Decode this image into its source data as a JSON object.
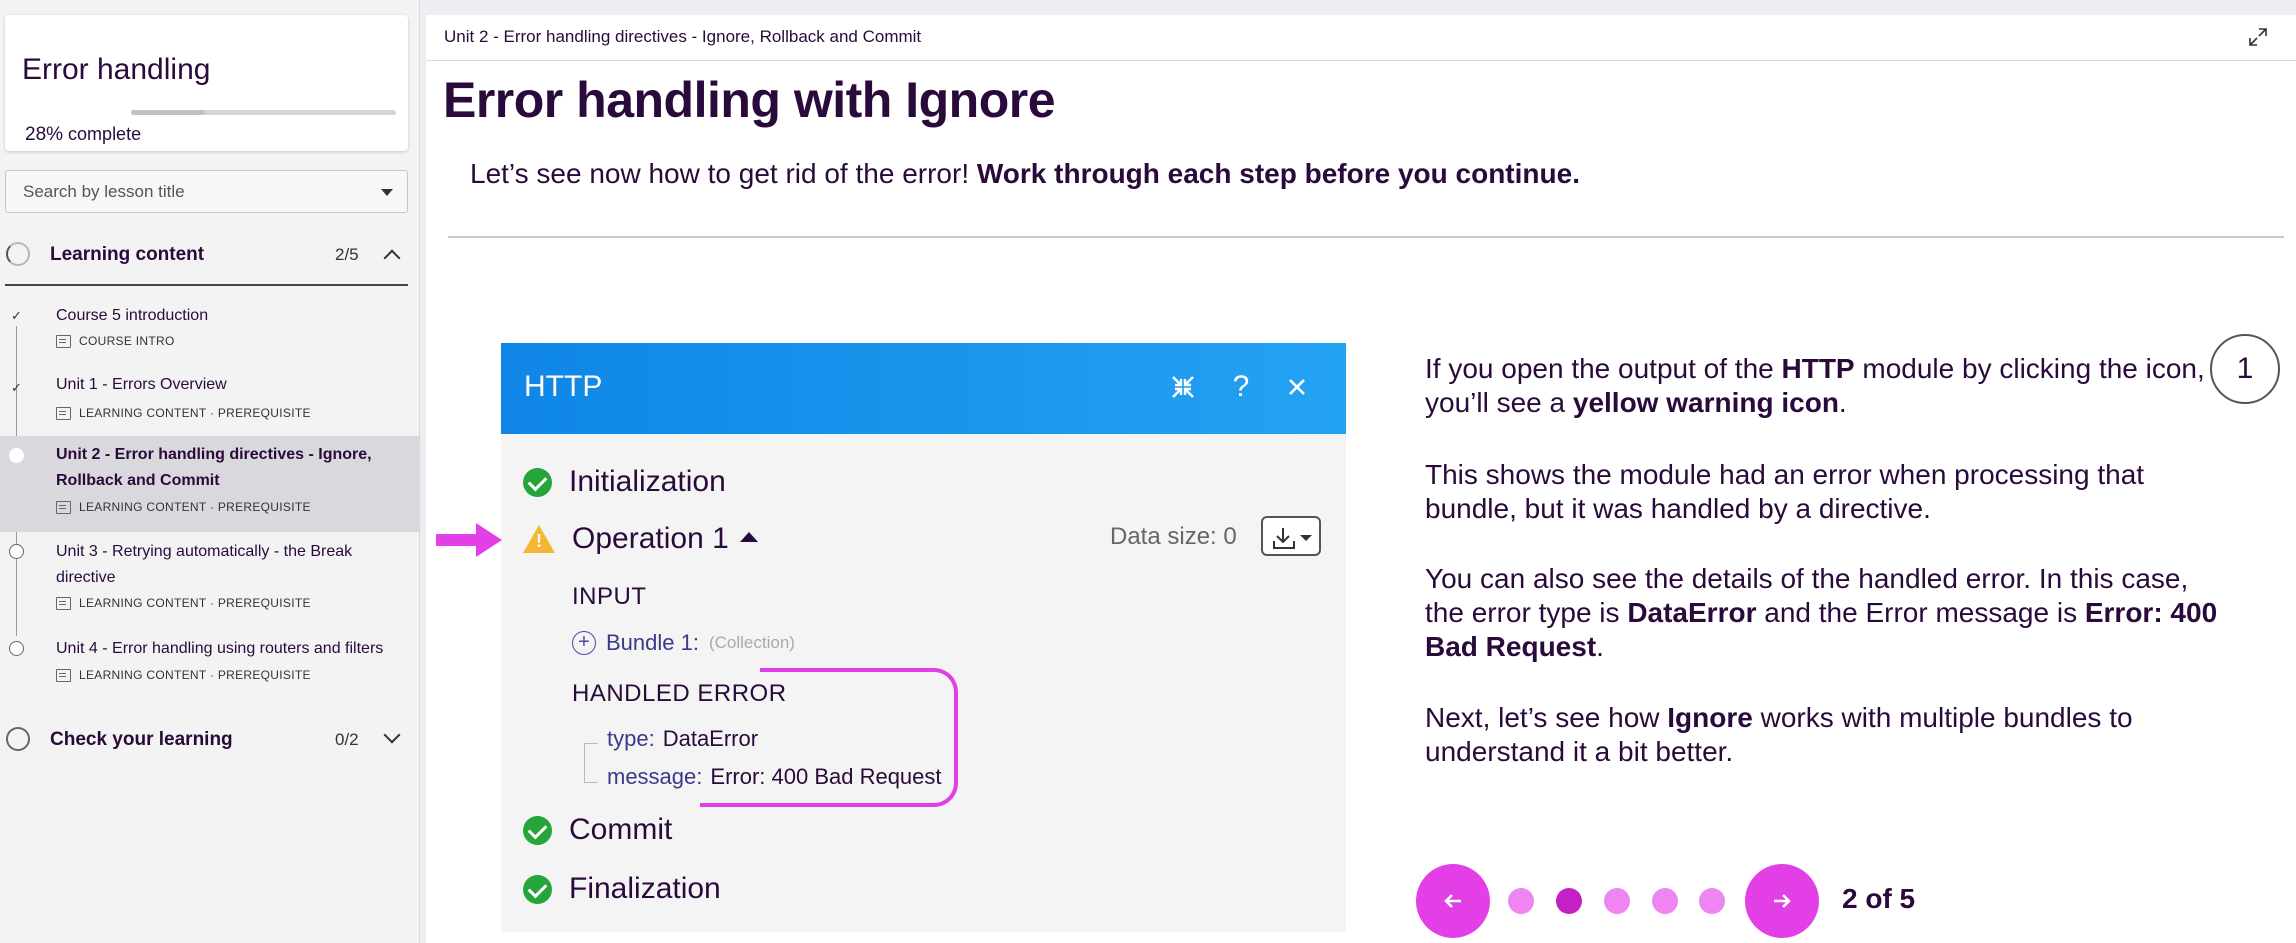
{
  "sidebar": {
    "course_title": "Error handling",
    "progress_value": "28%",
    "progress_suffix": "complete",
    "progress_fraction": 0.28,
    "search_placeholder": "Search by lesson title",
    "sections": [
      {
        "label": "Learning content",
        "count": "2/5",
        "expanded": true
      },
      {
        "label": "Check your learning",
        "count": "0/2",
        "expanded": false
      }
    ],
    "lessons": [
      {
        "title": "Course 5 introduction",
        "meta": "COURSE INTRO",
        "status": "done"
      },
      {
        "title": "Unit 1 - Errors Overview",
        "meta": "LEARNING CONTENT · PREREQUISITE",
        "status": "done"
      },
      {
        "title": "Unit 2 - Error handling directives - Ignore, Rollback and Commit",
        "meta": "LEARNING CONTENT · PREREQUISITE",
        "status": "current"
      },
      {
        "title": "Unit 3 - Retrying automatically - the Break directive",
        "meta": "LEARNING CONTENT · PREREQUISITE",
        "status": "todo"
      },
      {
        "title": "Unit 4 - Error handling using routers and filters",
        "meta": "LEARNING CONTENT · PREREQUISITE",
        "status": "todo"
      }
    ]
  },
  "main": {
    "breadcrumb": "Unit 2 - Error handling directives - Ignore, Rollback and Commit",
    "title": "Error handling with Ignore",
    "intro_plain": "Let’s see now how to get rid of the error! ",
    "intro_bold": "Work through each step before you continue.",
    "http_panel": {
      "title": "HTTP",
      "steps": {
        "initialization": "Initialization",
        "operation": "Operation 1",
        "commit": "Commit",
        "finalization": "Finalization"
      },
      "data_size": "Data size: 0",
      "input_label": "INPUT",
      "bundle_label": "Bundle 1:",
      "bundle_type": "(Collection)",
      "handled_error_label": "HANDLED ERROR",
      "type_key": "type:",
      "type_value": "DataError",
      "message_key": "message:",
      "message_value": "Error: 400 Bad Request"
    },
    "explanation": {
      "p1a": "If you open the output of the ",
      "p1b": "HTTP",
      "p1c": " module by clicking the icon, you’ll see a ",
      "p1d": "yellow warning icon",
      "p1e": ".",
      "p2": "This shows the module had an error when processing that bundle, but it was handled by a directive.",
      "p3a": "You can also see the details of the handled error. In this case, the error type is ",
      "p3b": "DataError",
      "p3c": " and the Error message is ",
      "p3d": "Error: 400 Bad Request",
      "p3e": ".",
      "p4a": "Next, let’s see how ",
      "p4b": "Ignore",
      "p4c": " works with multiple bundles to understand it a bit better."
    },
    "step_marker": "1",
    "pager": {
      "current": 2,
      "total": 5,
      "label": "2 of 5"
    }
  },
  "colors": {
    "accent": "#e33fe6",
    "http_blue": "#1a94ec",
    "success": "#25a53a",
    "warning": "#f5b731",
    "text": "#2a0a3a"
  }
}
